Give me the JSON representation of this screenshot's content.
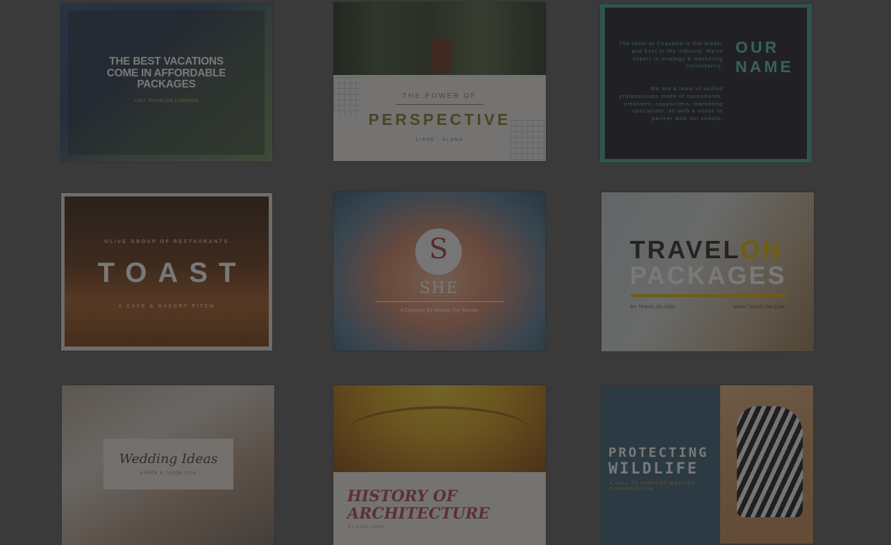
{
  "templates": [
    {
      "id": "vacations",
      "title": "THE BEST VACATIONS COME IN AFFORDABLE PACKAGES",
      "url": "VISIT TRAVELON.COM/NOW"
    },
    {
      "id": "perspective",
      "kicker": "THE POWER OF",
      "title": "PERSPECTIVE",
      "subtitle": "LIANE · ALANA"
    },
    {
      "id": "our-name",
      "title_line1": "OUR",
      "title_line2": "NAME",
      "block1": "The team at Coquette is the leader and best in the industry. We're expert in strategy & marketing consultancy.",
      "block2": "We are a team of skilled professionals made of consultants, creatives, copywriters, marketing specialists, all with a vision to partner with our clients."
    },
    {
      "id": "toast",
      "kicker": "OLIVE GROUP OF RESTAURANTS",
      "title": "TOAST",
      "subtitle": "A CAFE & BAKERY PITCH"
    },
    {
      "id": "she",
      "monogram": "S",
      "title": "SHE",
      "subtitle": "A Company By Women, For Women"
    },
    {
      "id": "travel-on",
      "title_part1": "TRAVEL",
      "title_accent": "ON",
      "title_line2": "PACKAGES",
      "left_note": "BY TRAVELON.COM",
      "right_note": "WWW.TRAVELON.COM"
    },
    {
      "id": "wedding",
      "title": "Wedding Ideas",
      "subtitle": "KAREN & JACOB 2018"
    },
    {
      "id": "architecture",
      "title_line1": "HISTORY OF",
      "title_line2": "ARCHITECTURE",
      "subtitle": "BY NAME HERE"
    },
    {
      "id": "wildlife",
      "title_line1": "PROTECTING",
      "title_line2": "WILDLIFE",
      "subtitle": "A CALL TO SUPPORT WILDLIFE CONSERVATION"
    }
  ],
  "colors": {
    "overlay": "#202020",
    "gold": "#e6b800",
    "teal": "#5ec5b3",
    "rose": "#b54a63"
  }
}
